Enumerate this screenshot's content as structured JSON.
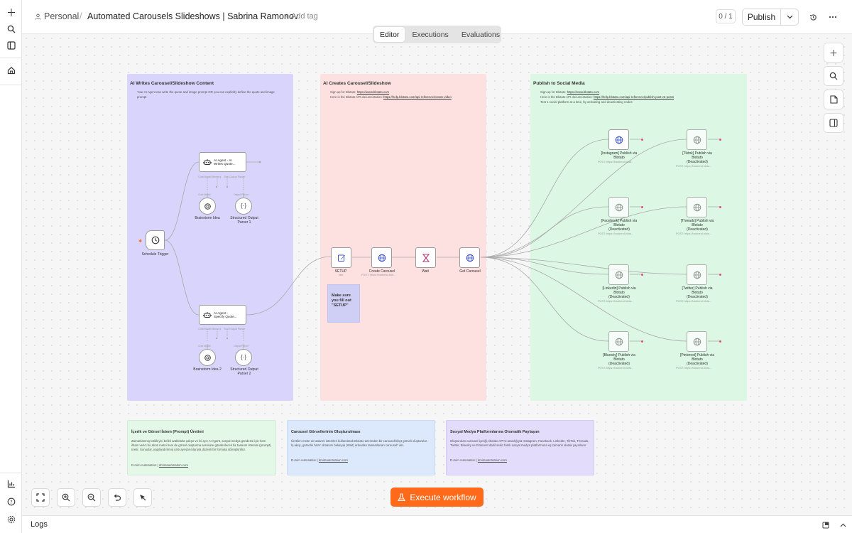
{
  "header": {
    "workspace": "Personal",
    "separator": "/",
    "title": "Automated Carousels Slideshows | Sabrina Ramonov",
    "add_tag": "+ Add tag",
    "version_counter": "0 / 1",
    "publish_label": "Publish"
  },
  "tabs": [
    {
      "label": "Editor",
      "active": true
    },
    {
      "label": "Executions",
      "active": false
    },
    {
      "label": "Evaluations",
      "active": false
    }
  ],
  "groups": {
    "writes": {
      "title": "AI Writes Carousel/Slideshow Content",
      "desc1": "Your AI Agent can write the quote and image prompt OR you can explicitly define the quote and image",
      "desc2": "prompt"
    },
    "creates": {
      "title": "AI Creates Carousel/Slideshow",
      "signup_prefix": "Sign up for Blotato:",
      "signup_link": "https://www.blotato.com",
      "docs_prefix": "Here is the Blotato API documentation:",
      "docs_link": "https://help.blotato.com/api-reference/create-video"
    },
    "publish": {
      "title": "Publish to Social Media",
      "signup_prefix": "Sign up for Blotato:",
      "signup_link": "https://www.blotato.com",
      "docs_prefix": "Here is the Blotato API documentation:",
      "docs_link": "https://help.blotato.com/api-reference/publish-post-v2-posts",
      "test_note": "Test 1 social platform at a time, by activating and deactivating nodes"
    }
  },
  "nodes": {
    "schedule": "Schedule Trigger",
    "agent1_line1": "AI Agent - AI",
    "agent1_line2": "Writes Quote...",
    "agent2_line1": "AI Agent -",
    "agent2_line2": "Specify Quote...",
    "port_chat": "Chat Model",
    "port_memory": "Memory",
    "port_tool": "Tool",
    "port_parser": "Output Parser",
    "brainstorm1": "Brainstorm Idea",
    "parser1_line1": "Structured Output",
    "parser1_line2": "Parser 1",
    "brainstorm2": "Brainstorm Idea 2",
    "parser2_line1": "Structured Output",
    "parser2_line2": "Parser 2",
    "setup": "SETUP",
    "setup_sub": "raw",
    "create_carousel": "Create Carousel",
    "create_sub": "POST: https://backend.blot...",
    "wait": "Wait",
    "get_carousel": "Get Carousel",
    "setup_note": "Make sure you fill out \"SETUP\"",
    "post_sub": "POST: https://backend.blota...",
    "instagram_line1": "[Instagram] Publish via",
    "instagram_line2": "Blotato",
    "tiktok_line1": "[Tiktok] Publish via",
    "tiktok_line2": "Blotato",
    "facebook_line1": "[Facebook] Publish via",
    "facebook_line2": "Blotato",
    "threads_line1": "[Threads] Publish via",
    "threads_line2": "Blotato",
    "linkedin_line1": "[Linkedin] Publish via",
    "linkedin_line2": "Blotato",
    "twitter_line1": "[Twitter] Publish via",
    "twitter_line2": "Blotato",
    "bluesky_line1": "[Bluesky] Publish via",
    "bluesky_line2": "Blotato",
    "pinterest_line1": "[Pinterest] Publish via",
    "pinterest_line2": "Blotato",
    "deactivated": "(Deactivated)"
  },
  "stickies": [
    {
      "title": "İçerik ve Görsel İstem (Prompt) Üretimi",
      "body": "Zamanlanmış tetikleyici belirli aralıklarla çalışır ve iki ayrı AI Agent, sosyal medya gönderisi için hem ilham verici bir alıntı metni hem de görsel oluşturma servisine gönderilecek bir tasarım istemini (prompt) üretir. Sonuçlar, yapılandırılmış çıktı ayrıştırıcılarıyla düzenli bir formata dönüştürülür.",
      "footer_prefix": "D-mim Automation |",
      "footer_link": "dmimautomation.com"
    },
    {
      "title": "Carousel Görsellerinin Oluşturulması",
      "body": "Üretilen metin ve tasarım istemleri kullanılarak Blotato üzerinden bir carousel/slayt görseli oluşturulur. İş akışı, görselin hazır olmasını bekleyip (Wait) ardından tamamlanan carousel'i alır.",
      "footer_prefix": "D-mim Automation |",
      "footer_link": "dmimautomation.com"
    },
    {
      "title": "Sosyal Medya Platformlarına Otomatik Paylaşım",
      "body": "Oluşturulan carousel içeriği, Blotato API'si aracılığıyla Instagram, Facebook, LinkedIn, TikTok, Threads, Twitter, Bluesky ve Pinterest dahil sekiz farklı sosyal medya platformuna eş zamanlı olarak yayınlanır.",
      "footer_prefix": "D-mim Automation |",
      "footer_link": "dmimautomation.com"
    }
  ],
  "canvas": {
    "execute_label": "Execute workflow"
  },
  "logs": {
    "label": "Logs"
  },
  "colors": {
    "writes_group": "#d9d4fb",
    "creates_group": "#fde0e0",
    "publish_group": "#dcf8e5",
    "sticky_green": "#e3f8e6",
    "sticky_blue": "#dce8fb",
    "sticky_purple": "#e4dcfb",
    "execute": "#ff6a1a"
  }
}
